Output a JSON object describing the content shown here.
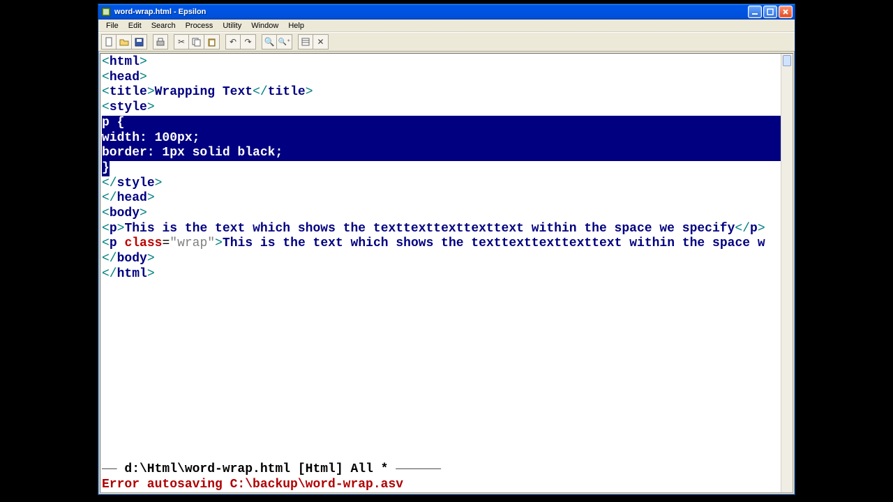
{
  "window": {
    "title": "word-wrap.html - Epsilon"
  },
  "menu": {
    "file": "File",
    "edit": "Edit",
    "search": "Search",
    "process": "Process",
    "utility": "Utility",
    "window": "Window",
    "help": "Help"
  },
  "code": {
    "l1_open": "<",
    "l1_tag": "html",
    "l1_close": ">",
    "l2_open": "<",
    "l2_tag": "head",
    "l2_close": ">",
    "l3_open": "<",
    "l3_tag": "title",
    "l3_close": ">",
    "l3_text": "Wrapping Text",
    "l3_open2": "</",
    "l3_tag2": "title",
    "l3_close2": ">",
    "l4_open": "<",
    "l4_tag": "style",
    "l4_close": ">",
    "sel1": "p {",
    "sel2": "width: 100px;",
    "sel3": "border: 1px solid black;",
    "sel4": "}",
    "l6_open": "</",
    "l6_tag": "style",
    "l6_close": ">",
    "l7_open": "</",
    "l7_tag": "head",
    "l7_close": ">",
    "l8_open": "<",
    "l8_tag": "body",
    "l8_close": ">",
    "l9_open": "<",
    "l9_tag": "p",
    "l9_close": ">",
    "l9_text": "This is the text which shows the texttexttexttexttext within the space we specify",
    "l9_open2": "</",
    "l9_tag2": "p",
    "l9_close2": ">",
    "l10_open": "<",
    "l10_tag": "p",
    "l10_sp": " ",
    "l10_attr": "class",
    "l10_eq": "=",
    "l10_q1": "\"",
    "l10_val": "wrap",
    "l10_q2": "\"",
    "l10_close": ">",
    "l10_text": "This is the text which shows the texttexttexttexttext within the space w",
    "l11_open": "</",
    "l11_tag": "body",
    "l11_close": ">",
    "l12_open": "</",
    "l12_tag": "html",
    "l12_close": ">"
  },
  "status": {
    "rule_left": "—— ",
    "path": "d:\\Html\\word-wrap.html [Html] All *",
    "rule_right": " ——————",
    "error": "Error autosaving C:\\backup\\word-wrap.asv"
  }
}
